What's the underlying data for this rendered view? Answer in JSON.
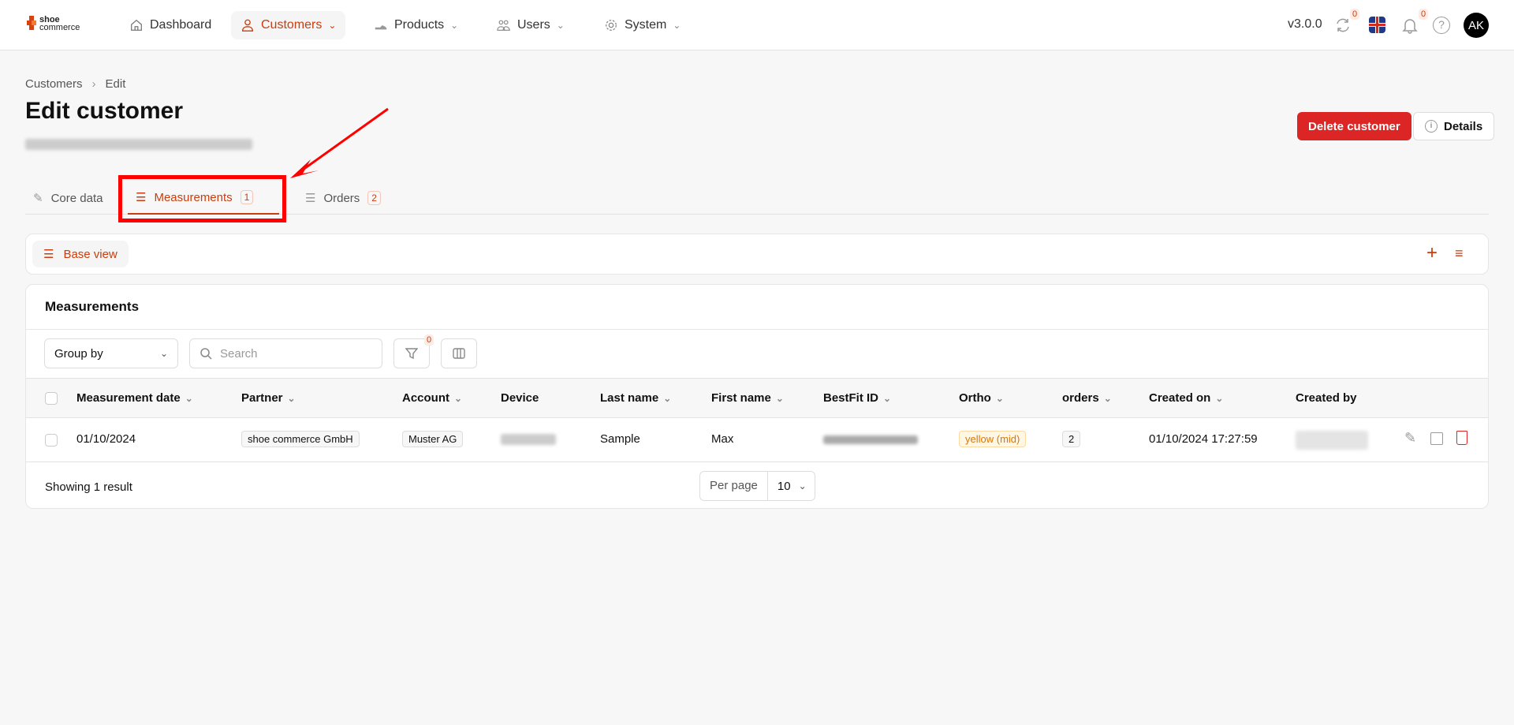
{
  "nav": {
    "logo_line1": "shoe",
    "logo_line2": "commerce",
    "items": [
      {
        "label": "Dashboard"
      },
      {
        "label": "Customers"
      },
      {
        "label": "Products"
      },
      {
        "label": "Users"
      },
      {
        "label": "System"
      }
    ],
    "version": "v3.0.0",
    "sync_count": "0",
    "notif_count": "0",
    "avatar": "AK"
  },
  "breadcrumb": [
    "Customers",
    "Edit"
  ],
  "page": {
    "title": "Edit customer",
    "delete_label": "Delete customer",
    "details_label": "Details"
  },
  "tabs": [
    {
      "label": "Core data"
    },
    {
      "label": "Measurements",
      "count": "1"
    },
    {
      "label": "Orders",
      "count": "2"
    }
  ],
  "views": {
    "base_view": "Base view"
  },
  "table": {
    "title": "Measurements",
    "group_by": "Group by",
    "search_placeholder": "Search",
    "filter_count": "0",
    "columns": [
      "Measurement date",
      "Partner",
      "Account",
      "Device",
      "Last name",
      "First name",
      "BestFit ID",
      "Ortho",
      "orders",
      "Created on",
      "Created by"
    ],
    "rows": [
      {
        "date": "01/10/2024",
        "partner": "shoe commerce GmbH",
        "account": "Muster AG",
        "last_name": "Sample",
        "first_name": "Max",
        "ortho": "yellow (mid)",
        "orders": "2",
        "created_on": "01/10/2024 17:27:59"
      }
    ],
    "showing": "Showing 1 result",
    "per_page_label": "Per page",
    "per_page": "10"
  },
  "colors": {
    "accent": "#c93d0f",
    "danger": "#dc2626",
    "ortho_yellow": "#d97706"
  }
}
